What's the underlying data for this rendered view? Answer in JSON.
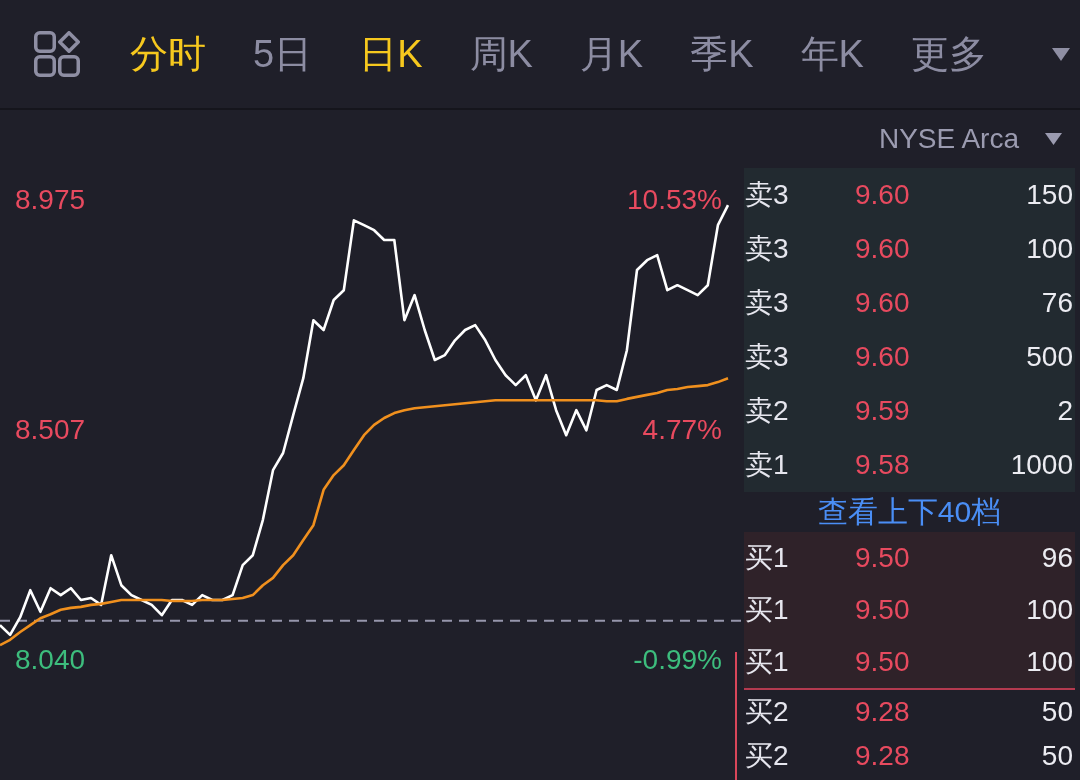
{
  "toolbar": {
    "tabs": [
      {
        "label": "分时",
        "selected": true
      },
      {
        "label": "5日",
        "selected": false
      },
      {
        "label": "日K",
        "selected": true
      },
      {
        "label": "周K",
        "selected": false
      },
      {
        "label": "月K",
        "selected": false
      },
      {
        "label": "季K",
        "selected": false
      },
      {
        "label": "年K",
        "selected": false
      },
      {
        "label": "更多",
        "selected": false
      }
    ]
  },
  "chart": {
    "chart_data": {
      "type": "line",
      "ylim": [
        7.796,
        9.382
      ],
      "yticks": [
        {
          "value": 8.975,
          "label": "8.975"
        },
        {
          "value": 8.507,
          "label": "8.507"
        },
        {
          "value": 8.04,
          "label": "8.040"
        }
      ],
      "series": [
        {
          "color": "#ffffff",
          "values": [
            8.111,
            8.091,
            8.127,
            8.182,
            8.138,
            8.186,
            8.172,
            8.186,
            8.162,
            8.166,
            8.152,
            8.253,
            8.192,
            8.172,
            8.162,
            8.152,
            8.131,
            8.162,
            8.162,
            8.152,
            8.172,
            8.162,
            8.162,
            8.172,
            8.233,
            8.253,
            8.325,
            8.426,
            8.461,
            8.538,
            8.613,
            8.731,
            8.711,
            8.772,
            8.792,
            8.934,
            8.924,
            8.914,
            8.894,
            8.894,
            8.731,
            8.782,
            8.711,
            8.65,
            8.66,
            8.69,
            8.711,
            8.721,
            8.69,
            8.65,
            8.619,
            8.599,
            8.619,
            8.568,
            8.619,
            8.548,
            8.497,
            8.548,
            8.507,
            8.589,
            8.599,
            8.589,
            8.67,
            8.833,
            8.853,
            8.863,
            8.792,
            8.802,
            8.792,
            8.782,
            8.802,
            8.924,
            8.965
          ]
        },
        {
          "color": "#f0901e",
          "values": [
            8.07,
            8.081,
            8.097,
            8.111,
            8.125,
            8.133,
            8.142,
            8.146,
            8.148,
            8.152,
            8.154,
            8.158,
            8.162,
            8.162,
            8.162,
            8.162,
            8.162,
            8.16,
            8.16,
            8.16,
            8.162,
            8.162,
            8.162,
            8.164,
            8.166,
            8.172,
            8.192,
            8.207,
            8.233,
            8.253,
            8.284,
            8.314,
            8.386,
            8.416,
            8.436,
            8.467,
            8.497,
            8.518,
            8.532,
            8.542,
            8.548,
            8.552,
            8.554,
            8.556,
            8.558,
            8.56,
            8.562,
            8.564,
            8.566,
            8.568,
            8.568,
            8.568,
            8.568,
            8.568,
            8.568,
            8.568,
            8.568,
            8.568,
            8.568,
            8.568,
            8.566,
            8.566,
            8.571,
            8.575,
            8.579,
            8.583,
            8.589,
            8.591,
            8.595,
            8.597,
            8.599,
            8.605,
            8.613
          ]
        }
      ],
      "ref_lines": [
        {
          "axis": "y",
          "value": 8.12
        }
      ]
    },
    "change_labels": [
      "10.53%",
      "4.77%",
      "-0.99%"
    ]
  },
  "order_book": {
    "exchange": "NYSE Arca",
    "asks": [
      {
        "level": "卖3",
        "price": "9.60",
        "volume": "150"
      },
      {
        "level": "卖3",
        "price": "9.60",
        "volume": "100"
      },
      {
        "level": "卖3",
        "price": "9.60",
        "volume": "76"
      },
      {
        "level": "卖3",
        "price": "9.60",
        "volume": "500"
      },
      {
        "level": "卖2",
        "price": "9.59",
        "volume": "2"
      },
      {
        "level": "卖1",
        "price": "9.58",
        "volume": "1000"
      }
    ],
    "depth_link": "查看上下40档",
    "bids": [
      {
        "level": "买1",
        "price": "9.50",
        "volume": "96",
        "highlighted": true
      },
      {
        "level": "买1",
        "price": "9.50",
        "volume": "100",
        "highlighted": true
      },
      {
        "level": "买1",
        "price": "9.50",
        "volume": "100",
        "highlighted": true
      },
      {
        "level": "买2",
        "price": "9.28",
        "volume": "50",
        "highlighted": false
      },
      {
        "level": "买2",
        "price": "9.28",
        "volume": "50",
        "highlighted": false
      }
    ]
  }
}
